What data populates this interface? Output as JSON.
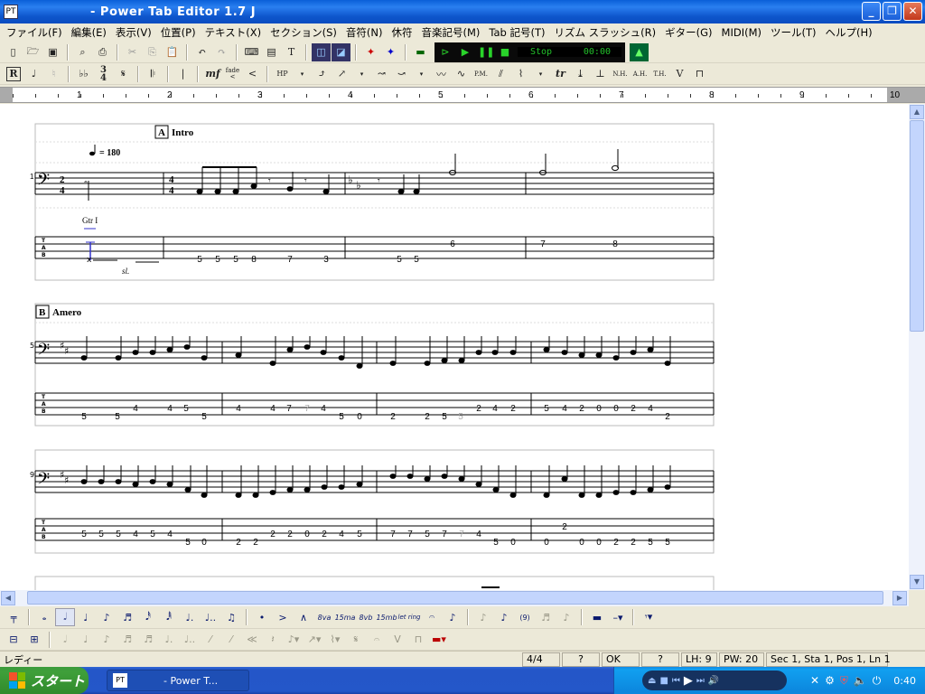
{
  "window": {
    "title": "- Power Tab Editor 1.7 J",
    "icon_label": "PT"
  },
  "menu": [
    "ファイル(F)",
    "編集(E)",
    "表示(V)",
    "位置(P)",
    "テキスト(X)",
    "セクション(S)",
    "音符(N)",
    "休符",
    "音楽記号(M)",
    "Tab 記号(T)",
    "リズム スラッシュ(R)",
    "ギター(G)",
    "MIDI(M)",
    "ツール(T)",
    "ヘルプ(H)"
  ],
  "toolbar1": {
    "file_icons": [
      "new-icon",
      "open-icon",
      "save-icon",
      "print-preview-icon",
      "print-icon",
      "cut-icon",
      "copy-icon",
      "paste-icon",
      "undo-icon",
      "redo-icon"
    ],
    "player_status": "Stop",
    "player_time": "00:00"
  },
  "toolbar2": {
    "rehearsal": "R",
    "time_sig_top": "3",
    "time_sig_bottom": "4",
    "dynamic": "mf",
    "fade": "fade",
    "items": [
      "ℍ",
      "♩",
      "b",
      "♭♭",
      "¾",
      "𝄋",
      "𝄀",
      "𝄁",
      "mf",
      "≺",
      "<",
      "HP",
      "⤴",
      "↗",
      "↝",
      "⤻",
      "~",
      "⤴",
      "PM",
      "𝄞",
      "tr",
      "⌫",
      "⊻",
      "NH",
      "AH",
      "TH",
      "V",
      "▭"
    ]
  },
  "ruler": {
    "numbers": [
      "1",
      "2",
      "3",
      "4",
      "5",
      "6",
      "7",
      "8",
      "9",
      "10"
    ]
  },
  "score": {
    "sections": [
      {
        "letter": "A",
        "name": "Intro",
        "tempo": "= 180",
        "guitar": "Gtr I",
        "slide": "sl.",
        "system_number": "1"
      },
      {
        "letter": "B",
        "name": "Amero",
        "system_number": "5"
      },
      {
        "system_number": "9"
      }
    ],
    "time_sig_a": [
      "2",
      "4"
    ],
    "time_sig_b": [
      "4",
      "4"
    ],
    "tab_labels": [
      "T",
      "A",
      "B"
    ],
    "system1_tab": [
      [
        "5",
        "5",
        "5",
        "8",
        "7",
        "3"
      ],
      [
        "5",
        "5",
        "6"
      ],
      [
        "7",
        "8"
      ]
    ],
    "system2_tab": [
      [
        "5",
        "5",
        "4",
        "4",
        "5",
        "5"
      ],
      [
        "4",
        "4",
        "7",
        "7",
        "4",
        "5",
        "0"
      ],
      [
        "2",
        "2",
        "5",
        "5",
        "2",
        "4",
        "2"
      ],
      [
        "5",
        "4",
        "2",
        "0",
        "0",
        "2",
        "4",
        "2"
      ]
    ],
    "system3_tab": [
      [
        "5",
        "5",
        "5",
        "4",
        "5",
        "4",
        "5",
        "0"
      ],
      [
        "2",
        "2",
        "2",
        "2",
        "0",
        "2",
        "4",
        "5"
      ],
      [
        "7",
        "7",
        "5",
        "7",
        "7",
        "4",
        "5",
        "0"
      ],
      [
        "0",
        "2",
        "0",
        "0",
        "2",
        "2",
        "5",
        "5"
      ]
    ]
  },
  "notes_toolbar": {
    "labels": [
      "8va",
      "15ma",
      "8vb",
      "15mb",
      "let ring",
      "(9)"
    ]
  },
  "statusbar": {
    "ready": "レディー",
    "time_sig": "4/4",
    "q1": "?",
    "ok": "OK",
    "q2": "?",
    "lh": "LH: 9",
    "pw": "PW: 20",
    "position": "Sec 1, Sta 1, Pos 1, Ln 1"
  },
  "taskbar": {
    "start": "スタート",
    "task": "- Power T...",
    "clock": "0:40"
  }
}
